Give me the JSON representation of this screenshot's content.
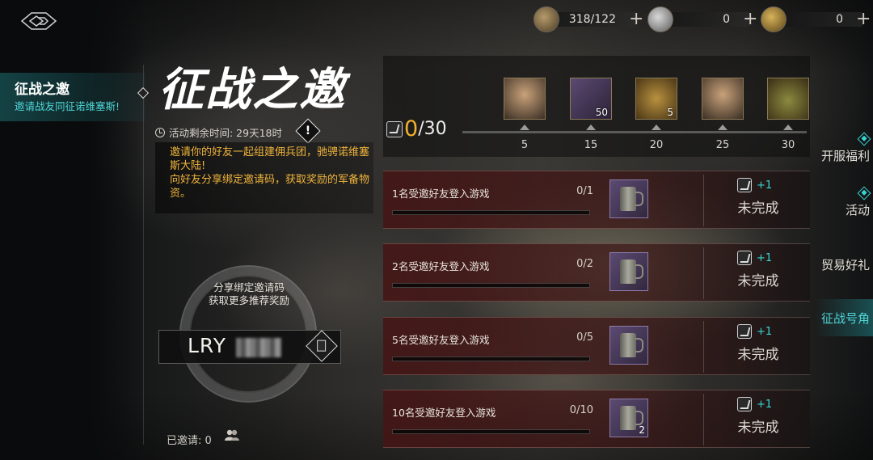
{
  "header": {
    "resources": [
      {
        "icon": "feather-scroll-icon",
        "value": "318/122",
        "plus": "+"
      },
      {
        "icon": "silver-coin-icon",
        "value": "0",
        "plus": "+"
      },
      {
        "icon": "gold-scroll-icon",
        "value": "0",
        "plus": "+"
      }
    ]
  },
  "left_nav": {
    "selected_title": "征战之邀",
    "selected_subtitle": "邀请战友同征诺维塞斯!"
  },
  "event": {
    "title": "征战之邀",
    "time_label": "活动剩余时间: 29天18时",
    "warn_glyph": "!",
    "description": "邀请你的好友一起组建佣兵团，驰骋诺维塞斯大陆!\n向好友分享绑定邀请码，获取奖励的军备物资。"
  },
  "share": {
    "text": "分享绑定邀请码\n获取更多推荐奖励",
    "code": "LRY",
    "invited_label": "已邀请: 0"
  },
  "milestone": {
    "current": "0",
    "max": "/30",
    "rewards": [
      {
        "threshold": "5",
        "icon": "hero-portrait-icon",
        "qty": ""
      },
      {
        "threshold": "15",
        "icon": "mug-bundle-icon",
        "qty": "50"
      },
      {
        "threshold": "20",
        "icon": "bronze-shield-icon",
        "qty": "5"
      },
      {
        "threshold": "25",
        "icon": "hero-portrait-icon",
        "qty": ""
      },
      {
        "threshold": "30",
        "icon": "treasure-chest-icon",
        "qty": ""
      }
    ]
  },
  "tasks": [
    {
      "name": "1名受邀好友登入游戏",
      "progress": "0/1",
      "item_qty": "",
      "reward": "+1",
      "status": "未完成"
    },
    {
      "name": "2名受邀好友登入游戏",
      "progress": "0/2",
      "item_qty": "",
      "reward": "+1",
      "status": "未完成"
    },
    {
      "name": "5名受邀好友登入游戏",
      "progress": "0/5",
      "item_qty": "",
      "reward": "+1",
      "status": "未完成"
    },
    {
      "name": "10名受邀好友登入游戏",
      "progress": "0/10",
      "item_qty": "2",
      "reward": "+1",
      "status": "未完成"
    }
  ],
  "right_nav": {
    "items": [
      "开服福利",
      "活动",
      "贸易好礼",
      "征战号角"
    ]
  },
  "colors": {
    "accent": "#4fd6d8",
    "highlight": "#f2b02c",
    "task_bg": "#461414"
  }
}
